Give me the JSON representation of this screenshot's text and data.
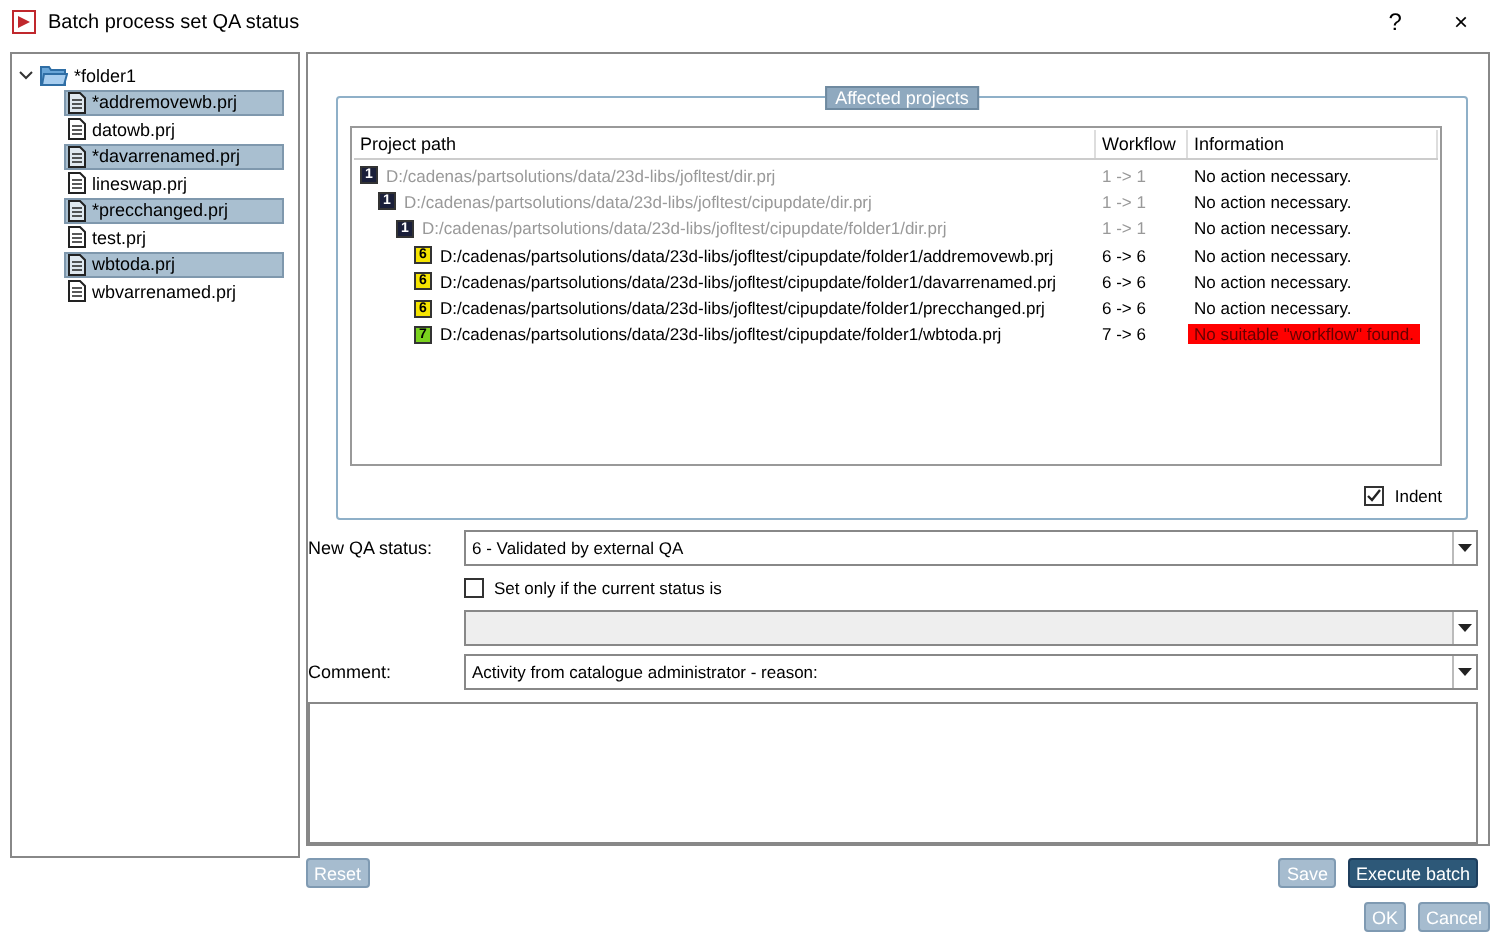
{
  "window": {
    "title": "Batch process set QA status",
    "help": "?",
    "close": "×"
  },
  "tree": {
    "label": "*folder1",
    "expanded": true,
    "children": [
      {
        "label": "*addremovewb.prj",
        "selected": true
      },
      {
        "label": "datowb.prj",
        "selected": false
      },
      {
        "label": "*davarrenamed.prj",
        "selected": true
      },
      {
        "label": "lineswap.prj",
        "selected": false
      },
      {
        "label": "*precchanged.prj",
        "selected": true
      },
      {
        "label": "test.prj",
        "selected": false
      },
      {
        "label": "wbtoda.prj",
        "selected": true
      },
      {
        "label": "wbvarrenamed.prj",
        "selected": false
      }
    ]
  },
  "affected": {
    "title": "Affected projects",
    "columns": [
      "Project path",
      "Workflow",
      "Information"
    ],
    "rows": [
      {
        "badge": "1",
        "color": "#1a1f3a",
        "path": "D:/cadenas/partsolutions/data/23d-libs/jofltest/dir.prj",
        "workflow": "1 -> 1",
        "info": "No action necessary.",
        "disabled": true,
        "error": false,
        "children": [
          {
            "badge": "1",
            "color": "#1a1f3a",
            "path": "D:/cadenas/partsolutions/data/23d-libs/jofltest/cipupdate/dir.prj",
            "workflow": "1 -> 1",
            "info": "No action necessary.",
            "disabled": true,
            "error": false,
            "children": [
              {
                "badge": "1",
                "color": "#1a1f3a",
                "path": "D:/cadenas/partsolutions/data/23d-libs/jofltest/cipupdate/folder1/dir.prj",
                "workflow": "1 -> 1",
                "info": "No action necessary.",
                "disabled": true,
                "error": false,
                "children": [
                  {
                    "badge": "6",
                    "color": "#f5e400",
                    "path": "D:/cadenas/partsolutions/data/23d-libs/jofltest/cipupdate/folder1/addremovewb.prj",
                    "workflow": "6 -> 6",
                    "info": "No action necessary.",
                    "disabled": false,
                    "error": false
                  },
                  {
                    "badge": "6",
                    "color": "#f5e400",
                    "path": "D:/cadenas/partsolutions/data/23d-libs/jofltest/cipupdate/folder1/davarrenamed.prj",
                    "workflow": "6 -> 6",
                    "info": "No action necessary.",
                    "disabled": false,
                    "error": false
                  },
                  {
                    "badge": "6",
                    "color": "#f5e400",
                    "path": "D:/cadenas/partsolutions/data/23d-libs/jofltest/cipupdate/folder1/precchanged.prj",
                    "workflow": "6 -> 6",
                    "info": "No action necessary.",
                    "disabled": false,
                    "error": false
                  },
                  {
                    "badge": "7",
                    "color": "#7ad21e",
                    "path": "D:/cadenas/partsolutions/data/23d-libs/jofltest/cipupdate/folder1/wbtoda.prj",
                    "workflow": "7 -> 6",
                    "info": "No suitable \"workflow\" found.",
                    "disabled": false,
                    "error": true
                  }
                ]
              }
            ]
          }
        ]
      }
    ],
    "indent": {
      "label": "Indent",
      "checked": true
    }
  },
  "new_qa_status": {
    "label": "New QA status:",
    "value": "6 - Validated by external QA"
  },
  "set_only": {
    "label": "Set only if the current status is",
    "checked": false,
    "disabled": true
  },
  "comment": {
    "label": "Comment:",
    "value": "Activity from catalogue administrator - reason:"
  },
  "buttons": [
    {
      "label": "Reset",
      "kind": "plain",
      "disabled": true
    },
    {
      "label": "Save",
      "kind": "plain",
      "disabled": true
    },
    {
      "label": "Execute batch",
      "kind": "primary",
      "disabled": false
    }
  ],
  "footer_buttons": [
    {
      "label": "OK",
      "disabled": true
    },
    {
      "label": "Cancel",
      "disabled": true
    }
  ]
}
